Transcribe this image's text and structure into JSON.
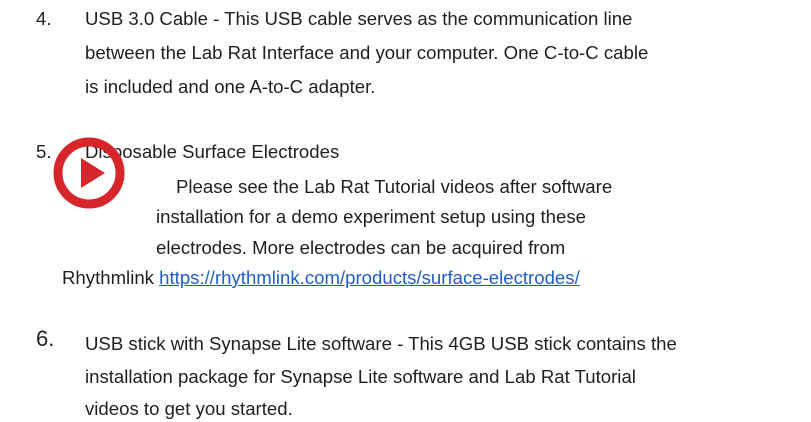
{
  "items": [
    {
      "number": "4.",
      "lines": [
        "USB 3.0 Cable - This USB cable serves as the communication line",
        "between the Lab Rat Interface and your computer. One C-to-C cable",
        "is included and one A-to-C adapter."
      ]
    },
    {
      "number": "5.",
      "title": "Disposable Surface Electrodes",
      "lines": [
        "Please see the Lab Rat Tutorial videos after software",
        "installation for a demo experiment setup using these",
        "electrodes. More electrodes can be acquired from"
      ],
      "last_prefix": "Rhythmlink",
      "link_text": "https://rhythmlink.com/products/surface-electrodes/"
    },
    {
      "number": "6.",
      "lines": [
        "USB stick with Synapse Lite software - This 4GB USB stick contains the",
        "installation package for Synapse Lite software and Lab Rat Tutorial",
        "videos to get you started."
      ]
    }
  ],
  "colors": {
    "play_icon": "#d7262b",
    "link": "#1f5ec4"
  },
  "icons": {
    "play": "play-icon"
  }
}
